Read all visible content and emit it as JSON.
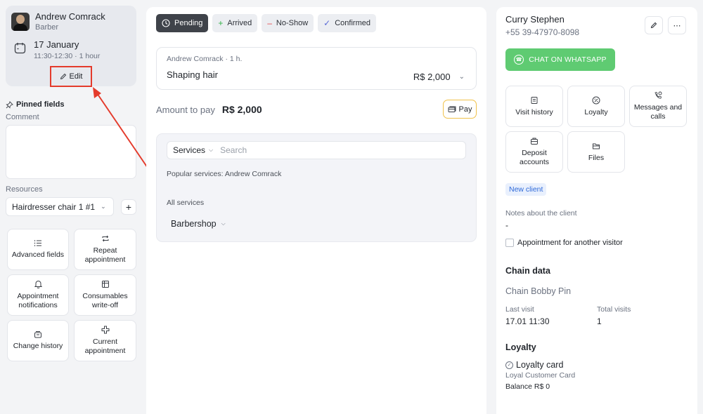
{
  "staff": {
    "name": "Andrew Comrack",
    "role": "Barber",
    "date": "17 January",
    "time_range": "11:30-12:30 · 1 hour",
    "edit_label": "Edit"
  },
  "left": {
    "pinned_label": "Pinned fields",
    "comment_label": "Comment",
    "resources_label": "Resources",
    "resource_value": "Hairdresser chair 1 #1",
    "tiles": [
      {
        "label": "Advanced fields",
        "icon": "list-icon"
      },
      {
        "label": "Repeat appointment",
        "icon": "repeat-icon"
      },
      {
        "label": "Appointment notifications",
        "icon": "bell-icon"
      },
      {
        "label": "Consumables write-off",
        "icon": "box-icon"
      },
      {
        "label": "Change history",
        "icon": "history-icon"
      },
      {
        "label": "Current appointment",
        "icon": "plus-icon"
      }
    ]
  },
  "statuses": [
    {
      "label": "Pending",
      "icon": "clock-icon",
      "active": true
    },
    {
      "label": "Arrived",
      "icon": "plus-icon",
      "color": "#35b34a"
    },
    {
      "label": "No-Show",
      "icon": "minus-icon",
      "color": "#e5484d"
    },
    {
      "label": "Confirmed",
      "icon": "check-icon",
      "color": "#5b6bd6"
    }
  ],
  "service": {
    "meta": "Andrew Comrack · 1 h.",
    "name": "Shaping hair",
    "price": "R$ 2,000"
  },
  "payment": {
    "label": "Amount to pay",
    "amount": "R$ 2,000",
    "pay_label": "Pay"
  },
  "catalog": {
    "dropdown": "Services",
    "search_placeholder": "Search",
    "popular": "Popular services: Andrew Comrack",
    "all_services": "All services",
    "category": "Barbershop"
  },
  "client": {
    "name": "Curry Stephen",
    "phone": "+55 39-47970-8098",
    "whatsapp_label": "CHAT ON WHATSAPP",
    "whatsapp_color": "#5fcb72",
    "tiles": [
      {
        "label": "Visit history",
        "icon": "receipt-icon"
      },
      {
        "label": "Loyalty",
        "icon": "percent-icon"
      },
      {
        "label": "Messages and calls",
        "icon": "phone-icon"
      },
      {
        "label": "Deposit accounts",
        "icon": "wallet-icon"
      },
      {
        "label": "Files",
        "icon": "folder-icon"
      }
    ],
    "badge": "New client",
    "notes_label": "Notes about the client",
    "notes_value": "-",
    "another_visitor": "Appointment for another visitor",
    "chain_title": "Chain data",
    "chain_name": "Chain Bobby Pin",
    "last_visit_label": "Last visit",
    "last_visit_value": "17.01 11:30",
    "total_visits_label": "Total visits",
    "total_visits_value": "1",
    "loyalty_title": "Loyalty",
    "loyalty_card": "Loyalty card",
    "loyalty_desc": "Loyal Customer Card",
    "balance": "Balance R$ 0"
  }
}
